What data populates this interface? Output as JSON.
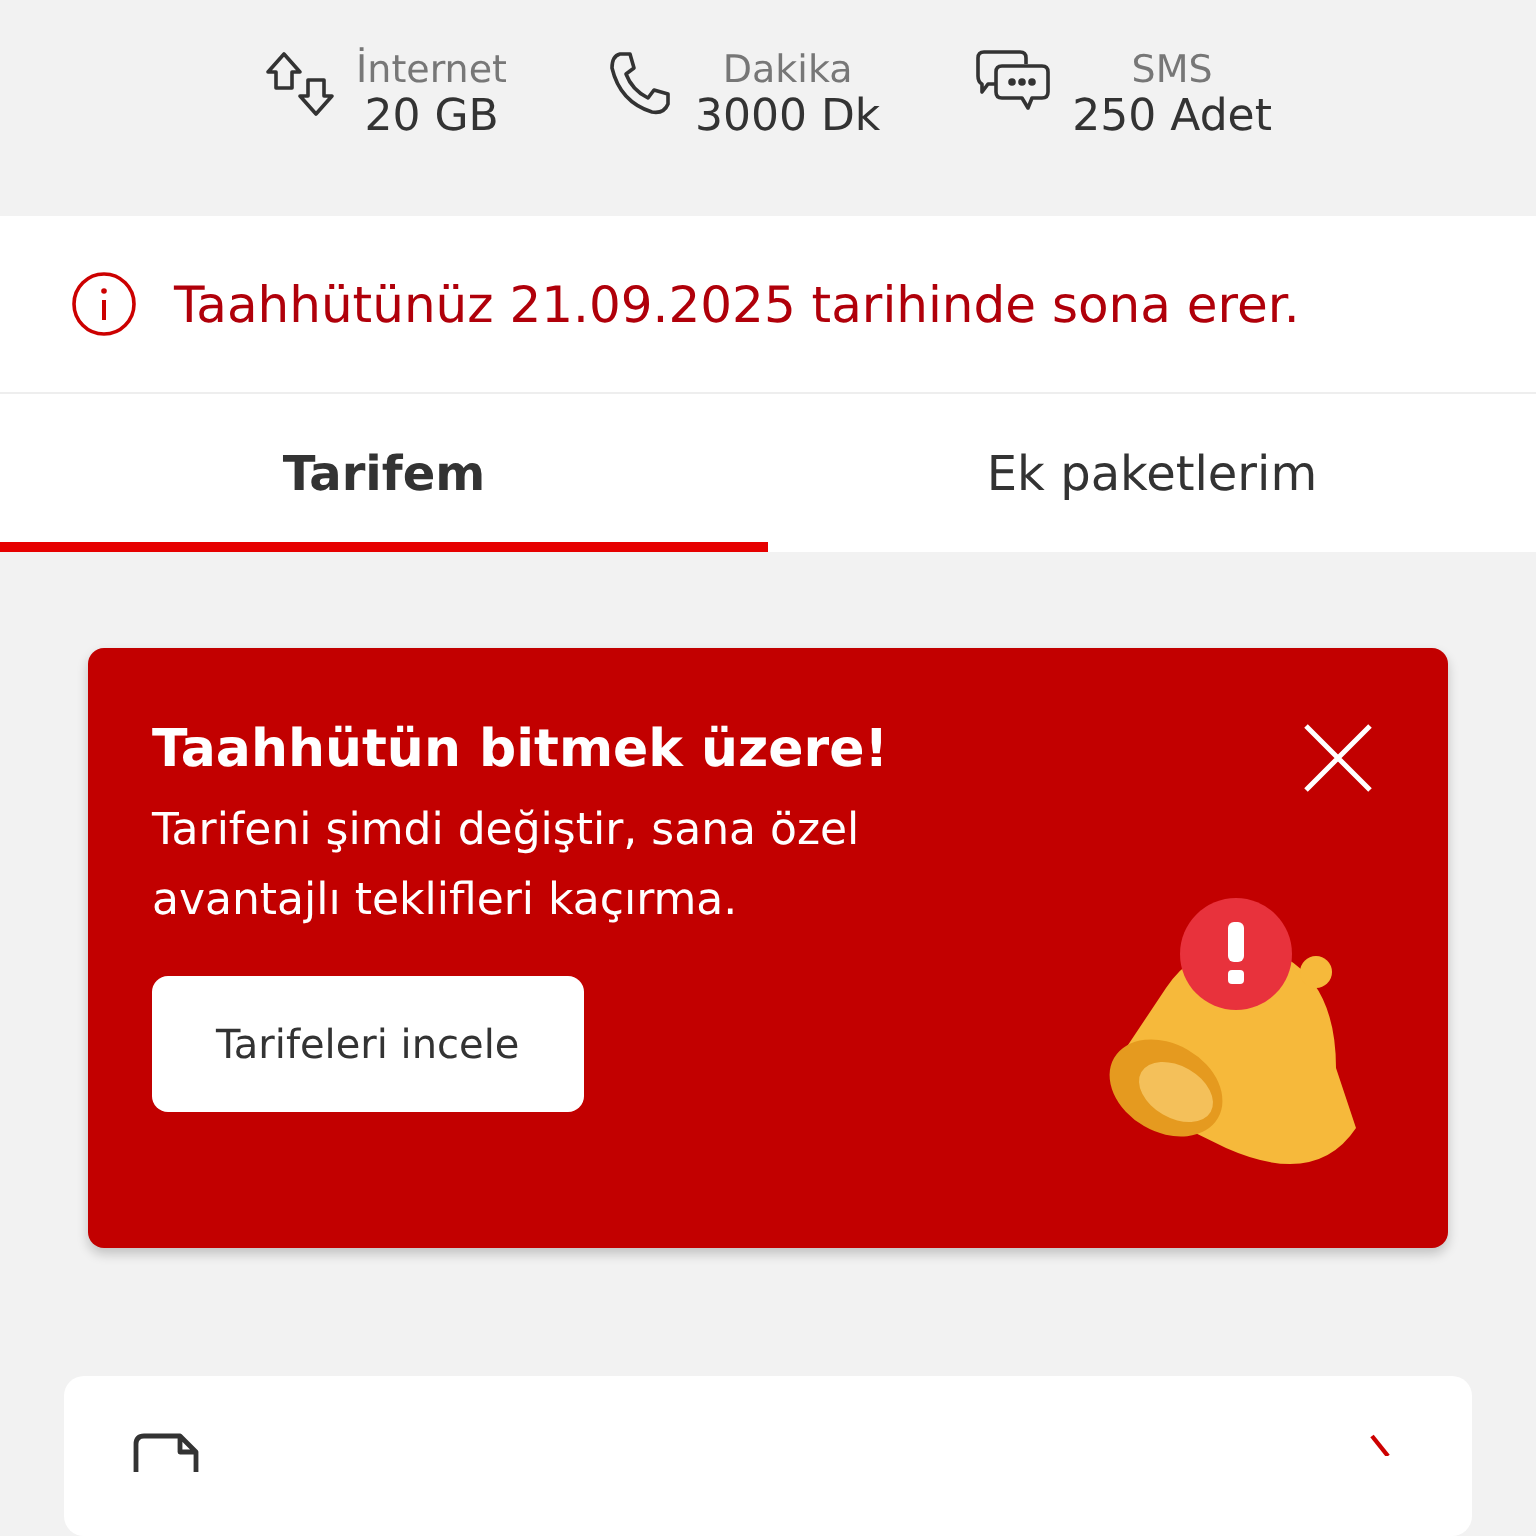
{
  "usage": [
    {
      "kind": "data",
      "label": "İnternet",
      "value": "20 GB"
    },
    {
      "kind": "voice",
      "label": "Dakika",
      "value": "3000 Dk"
    },
    {
      "kind": "sms",
      "label": "SMS",
      "value": "250 Adet"
    }
  ],
  "notice": {
    "text": "Taahhütünüz 21.09.2025 tarihinde sona erer."
  },
  "tabs": [
    {
      "label": "Tarifem",
      "selected": true
    },
    {
      "label": "Ek paketlerim",
      "selected": false
    }
  ],
  "banner": {
    "title": "Taahhütün bitmek üzere!",
    "text": "Tarifeni şimdi değiştir, sana özel avantajlı teklifleri kaçırma.",
    "button": "Tarifeleri incele"
  }
}
